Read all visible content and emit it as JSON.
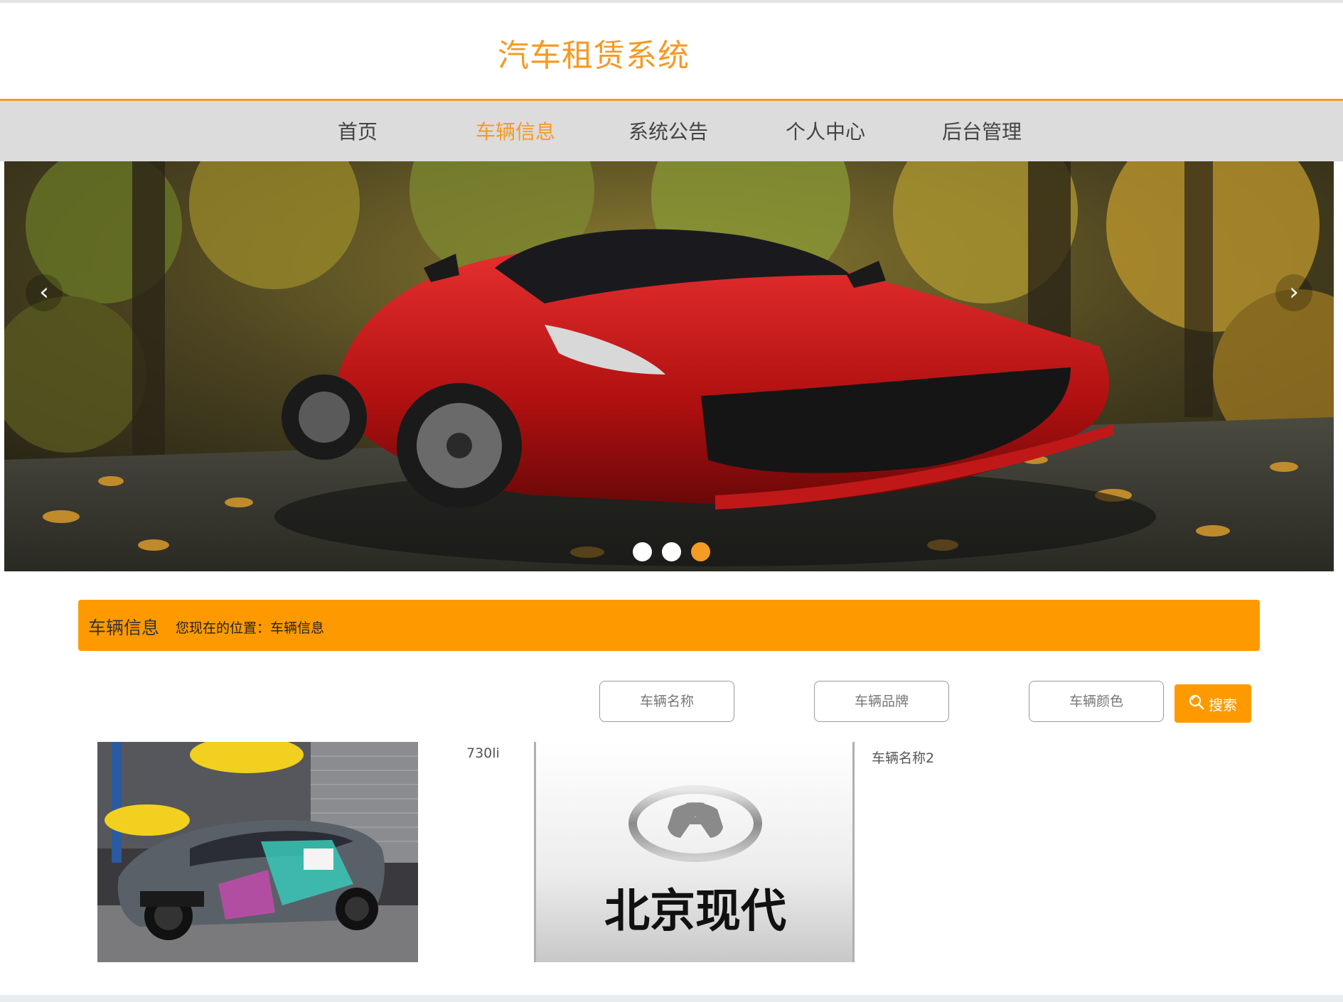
{
  "site": {
    "title": "汽车租赁系统"
  },
  "nav": {
    "items": [
      {
        "label": "首页"
      },
      {
        "label": "车辆信息"
      },
      {
        "label": "系统公告"
      },
      {
        "label": "个人中心"
      },
      {
        "label": "后台管理"
      }
    ],
    "active_index": 1
  },
  "carousel": {
    "prev_icon": "chevron-left-icon",
    "next_icon": "chevron-right-icon",
    "slide_count": 3,
    "active_slide": 3
  },
  "section": {
    "title": "车辆信息",
    "breadcrumb": "您现在的位置：车辆信息"
  },
  "search": {
    "name_placeholder": "车辆名称",
    "brand_placeholder": "车辆品牌",
    "color_placeholder": "车辆颜色",
    "button_label": "搜索",
    "button_icon": "search-icon"
  },
  "vehicles": [
    {
      "name": "730li"
    },
    {
      "name": "车辆名称2",
      "logo_text": "北京现代"
    }
  ],
  "colors": {
    "accent": "#f59a23",
    "bar": "#fe9a00",
    "nav_bg": "#dcdcdc"
  }
}
